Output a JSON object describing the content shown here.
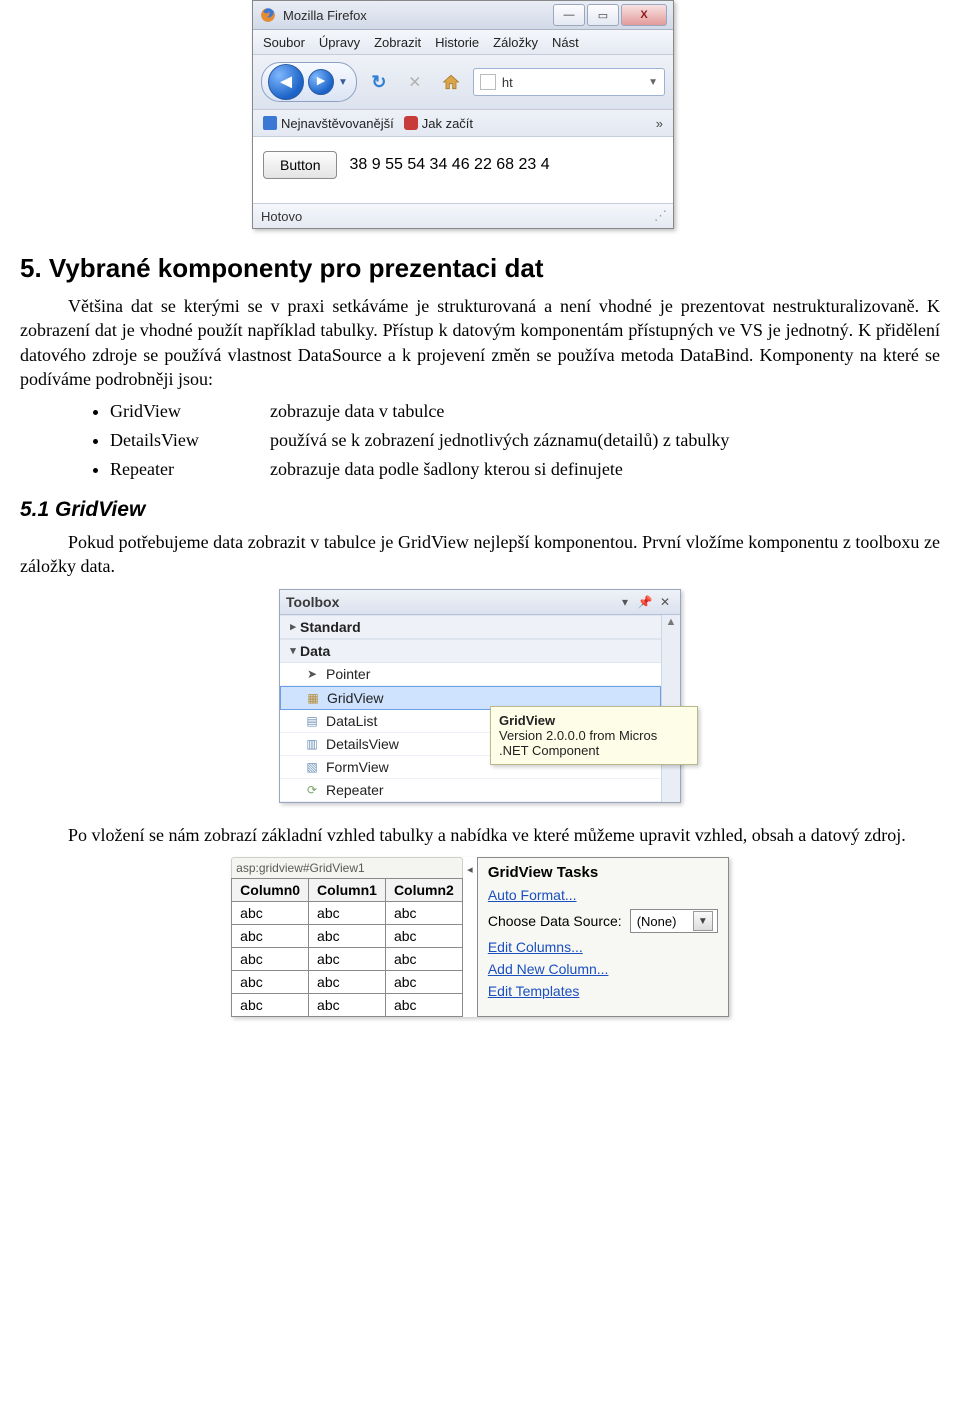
{
  "firefox": {
    "title": "Mozilla Firefox",
    "menu": [
      "Soubor",
      "Úpravy",
      "Zobrazit",
      "Historie",
      "Záložky",
      "Nást"
    ],
    "url_text": "ht",
    "bookmarks": {
      "most_visited": "Nejnavštěvovanější",
      "get_started": "Jak začít",
      "expand": "»"
    },
    "content_button": "Button",
    "content_text": "38 9 55 54 34 46 22 68 23 4",
    "status": "Hotovo"
  },
  "doc": {
    "section_title": "5. Vybrané komponenty pro prezentaci dat",
    "para1": "Většina dat se kterými se v praxi setkáváme je strukturovaná a není vhodné je prezentovat nestrukturalizovaně. K zobrazení dat je vhodné použít například tabulky. Přístup k datovým komponentám přístupných ve VS je jednotný. K přidělení datového zdroje se používá vlastnost DataSource a k projevení změn se používa metoda DataBind. Komponenty na které se podíváme podrobněji jsou:",
    "bullets": [
      {
        "term": "GridView",
        "desc": "zobrazuje data v tabulce"
      },
      {
        "term": "DetailsView",
        "desc": "používá se k zobrazení jednotlivých záznamu(detailů) z tabulky"
      },
      {
        "term": "Repeater",
        "desc": "zobrazuje data podle šadlony kterou si definujete"
      }
    ],
    "subsection_title": "5.1 GridView",
    "para2": "Pokud potřebujeme data zobrazit v tabulce je GridView nejlepší komponentou. První vložíme komponentu z toolboxu ze záložky data.",
    "para3": "Po vložení se nám zobrazí základní vzhled tabulky a nabídka ve které můžeme upravit vzhled, obsah a datový zdroj."
  },
  "toolbox": {
    "title": "Toolbox",
    "groups": {
      "standard": {
        "label": "Standard",
        "expanded": false
      },
      "data": {
        "label": "Data",
        "expanded": true,
        "items": [
          "Pointer",
          "GridView",
          "DataList",
          "DetailsView",
          "FormView",
          "Repeater"
        ],
        "selected": "GridView"
      }
    },
    "tooltip": {
      "title": "GridView",
      "line1": "Version 2.0.0.0 from Micros",
      "line2": ".NET Component"
    }
  },
  "gridview": {
    "tag": "asp:gridview#GridView1",
    "columns": [
      "Column0",
      "Column1",
      "Column2"
    ],
    "rows": [
      [
        "abc",
        "abc",
        "abc"
      ],
      [
        "abc",
        "abc",
        "abc"
      ],
      [
        "abc",
        "abc",
        "abc"
      ],
      [
        "abc",
        "abc",
        "abc"
      ],
      [
        "abc",
        "abc",
        "abc"
      ]
    ],
    "tasks": {
      "title": "GridView Tasks",
      "auto_format": "Auto Format...",
      "choose_ds_label": "Choose Data Source:",
      "choose_ds_value": "(None)",
      "edit_columns": "Edit Columns...",
      "add_column": "Add New Column...",
      "edit_templates": "Edit Templates"
    }
  }
}
